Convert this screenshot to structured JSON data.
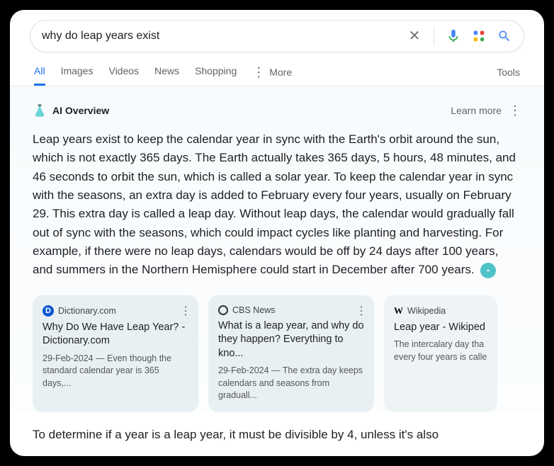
{
  "search": {
    "query": "why do leap years exist"
  },
  "tabs": {
    "items": [
      "All",
      "Images",
      "Videos",
      "News",
      "Shopping"
    ],
    "more": "More",
    "tools": "Tools"
  },
  "ai": {
    "label": "AI Overview",
    "learn_more": "Learn more",
    "body": "Leap years exist to keep the calendar year in sync with the Earth's orbit around the sun, which is not exactly 365 days. The Earth actually takes 365 days, 5 hours, 48 minutes, and 46 seconds to orbit the sun, which is called a solar year. To keep the calendar year in sync with the seasons, an extra day is added to February every four years, usually on February 29. This extra day is called a leap day. Without leap days, the calendar would gradually fall out of sync with the seasons, which could impact cycles like planting and harvesting. For example, if there were no leap days, calendars would be off by 24 days after 100 years, and summers in the Northern Hemisphere could start in December after 700 years.",
    "followup": "To determine if a year is a leap year, it must be divisible by 4, unless it's also"
  },
  "cards": [
    {
      "source": "Dictionary.com",
      "title": "Why Do We Have Leap Year? - Dictionary.com",
      "snippet": "29-Feb-2024 — Even though the standard calendar year is 365 days,..."
    },
    {
      "source": "CBS News",
      "title": "What is a leap year, and why do they happen? Everything to kno...",
      "snippet": "29-Feb-2024 — The extra day keeps calendars and seasons from graduall..."
    },
    {
      "source": "Wikipedia",
      "title": "Leap year - Wikiped",
      "snippet": "The intercalary day tha every four years is calle"
    }
  ]
}
